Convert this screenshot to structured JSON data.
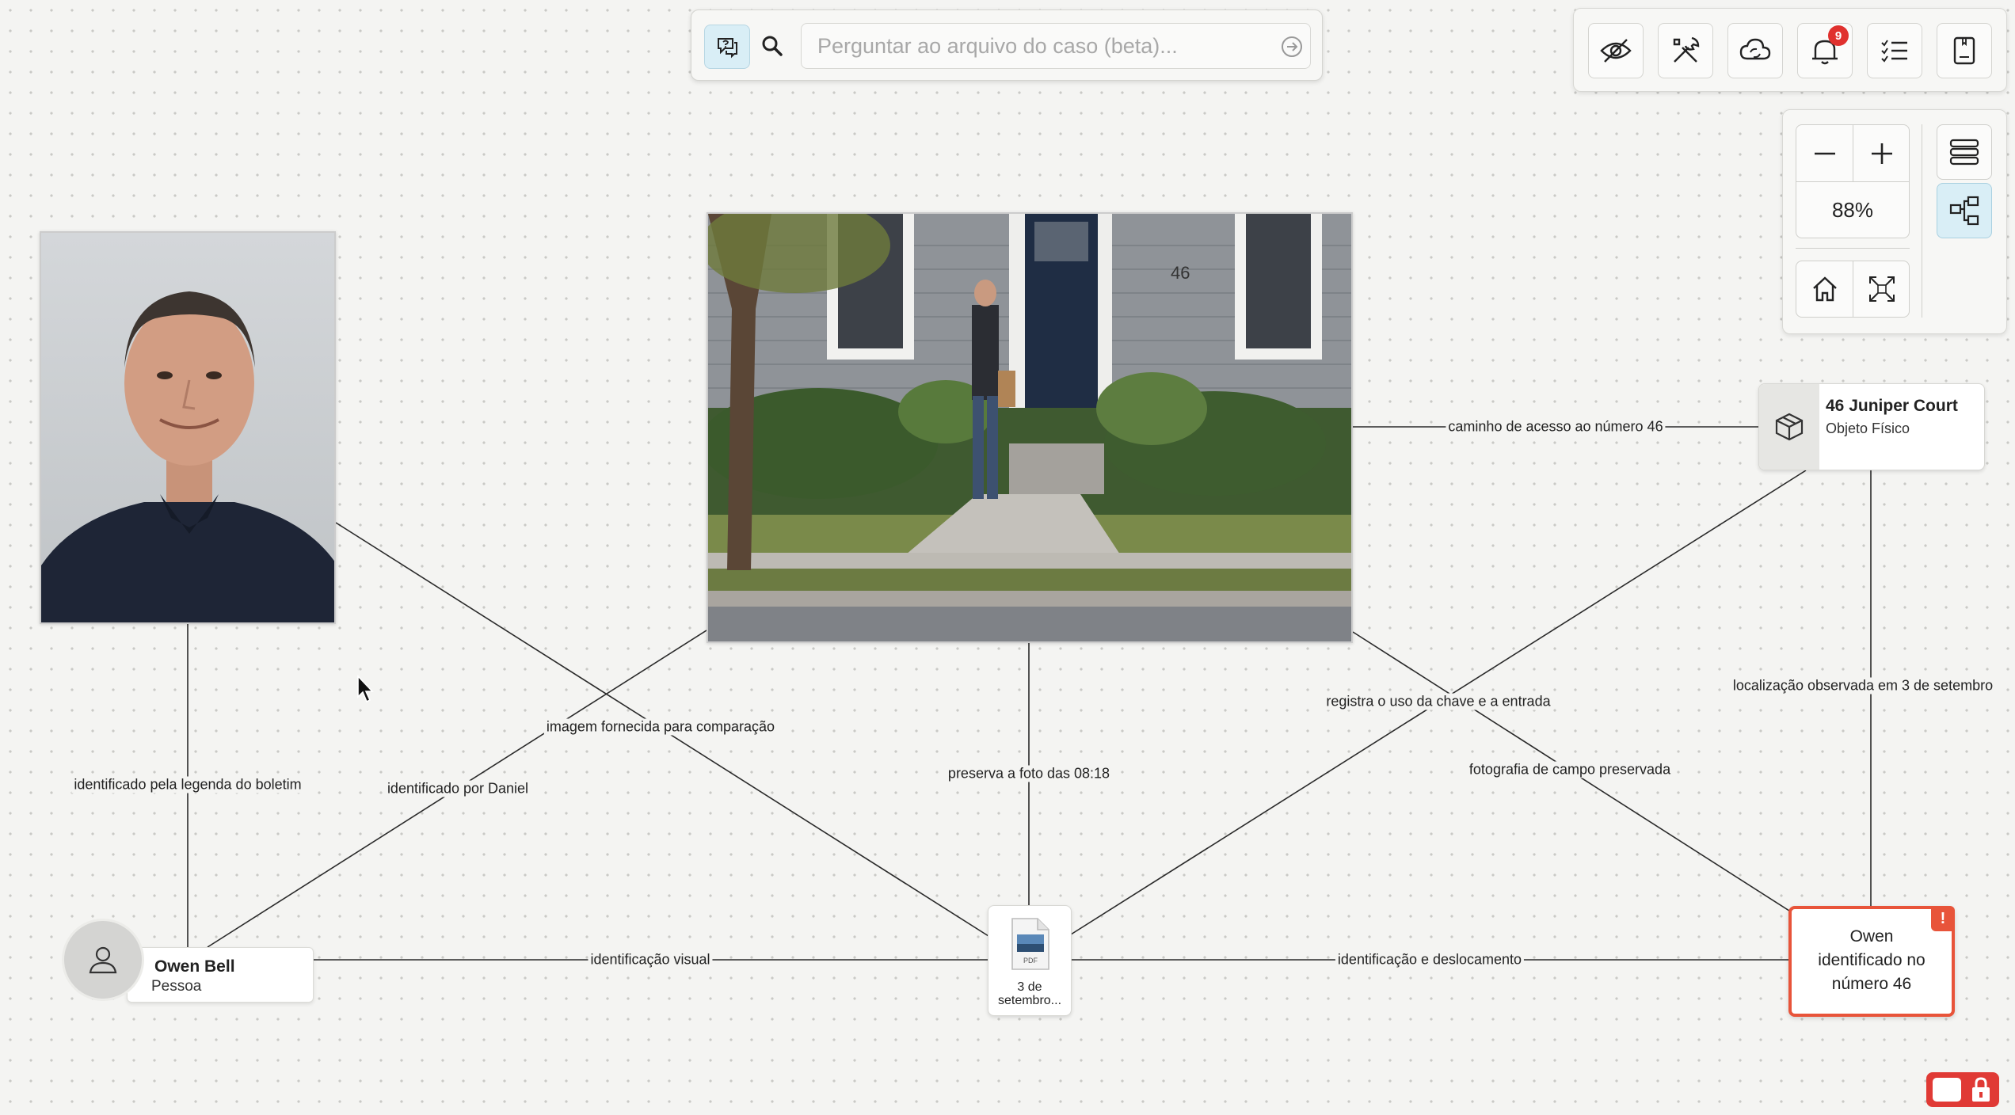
{
  "search": {
    "placeholder": "Perguntar ao arquivo do caso (beta)..."
  },
  "toolbar": {
    "buttons": [
      {
        "icon": "eye-off-icon"
      },
      {
        "icon": "tools-icon"
      },
      {
        "icon": "cloud-sync-icon"
      },
      {
        "icon": "bell-icon",
        "badge": "9"
      },
      {
        "icon": "checklist-icon"
      },
      {
        "icon": "notebook-icon"
      }
    ]
  },
  "zoom": {
    "level": "88%"
  },
  "nodes": {
    "location": {
      "title": "46 Juniper Court",
      "subtitle": "Objeto Físico"
    },
    "person": {
      "name": "Owen Bell",
      "type": "Pessoa"
    },
    "document": {
      "label_line1": "3 de",
      "label_line2": "setembro...",
      "file_type": "PDF"
    },
    "claim": {
      "line1": "Owen",
      "line2": "identificado no",
      "line3": "número 46",
      "flag": "!"
    },
    "house_photo": {
      "house_number": "46"
    }
  },
  "edges": [
    {
      "label": "caminho de acesso ao número 46"
    },
    {
      "label": "localização observada em 3 de setembro"
    },
    {
      "label": "registra o uso da chave e a entrada"
    },
    {
      "label": "fotografia de campo preservada"
    },
    {
      "label": "preserva a foto das 08:18"
    },
    {
      "label": "imagem fornecida para comparação"
    },
    {
      "label": "identificado por Daniel"
    },
    {
      "label": "identificado pela legenda do boletim"
    },
    {
      "label": "identificação visual"
    },
    {
      "label": "identificação e deslocamento"
    }
  ],
  "colors": {
    "accent": "#d9eef6",
    "alert": "#e8543a",
    "badge": "#e0312e",
    "canvas": "#f4f4f2"
  }
}
